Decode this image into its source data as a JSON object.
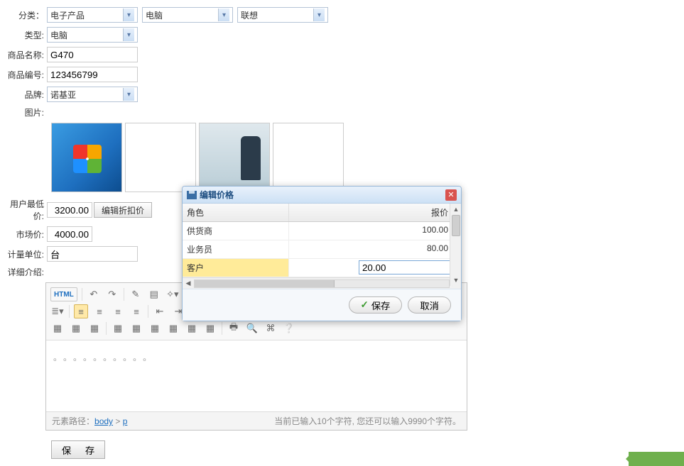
{
  "form": {
    "category_label": "分类：",
    "category1": "电子产品",
    "category2": "电脑",
    "category3": "联想",
    "type_label": "类型:",
    "type_value": "电脑",
    "name_label": "商品名称:",
    "name_value": "G470",
    "code_label": "商品编号:",
    "code_value": "123456799",
    "brand_label": "品牌:",
    "brand_value": "诺基亚",
    "image_label": "图片:",
    "user_low_label": "用户最低价:",
    "user_low_value": "3200.00",
    "discount_btn": "编辑折扣价",
    "market_label": "市场价:",
    "market_value": "4000.00",
    "unit_label": "计量单位:",
    "unit_value": "台",
    "detail_label": "详细介绍:",
    "save_btn": "保 存"
  },
  "editor": {
    "html_btn": "HTML",
    "body_dots": "。",
    "path_label": "元素路径：",
    "path_body": "body",
    "path_sep": " > ",
    "path_p": "p",
    "counter": "当前已输入10个字符, 您还可以输入9990个字符。"
  },
  "dialog": {
    "title": "编辑价格",
    "col_role": "角色",
    "col_price": "报价",
    "rows": [
      {
        "role": "供货商",
        "price": "100.00"
      },
      {
        "role": "业务员",
        "price": "80.00"
      }
    ],
    "edit_row": {
      "role": "客户",
      "price": "20.00"
    },
    "save": "保存",
    "cancel": "取消"
  }
}
